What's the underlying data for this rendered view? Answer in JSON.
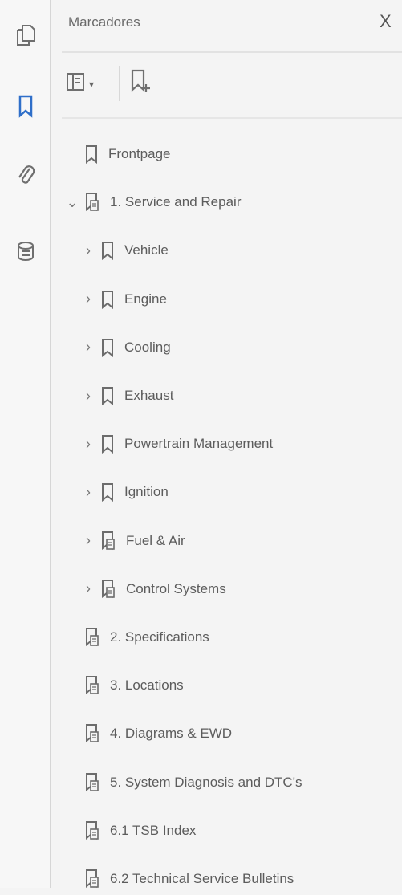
{
  "panel": {
    "title": "Marcadores",
    "close_label": "X"
  },
  "rail": {
    "icons": [
      "pages-icon",
      "bookmark-icon",
      "attachment-icon",
      "signature-icon"
    ]
  },
  "toolbar": {
    "options_icon": "bookmark-options-icon",
    "dropdown_icon": "chevron-down-icon",
    "new_bookmark_icon": "new-bookmark-icon"
  },
  "bookmarks": [
    {
      "label": "Frontpage",
      "level": 0,
      "expander": "none",
      "icon": "bookmark-icon"
    },
    {
      "label": "1. Service and Repair",
      "level": 0,
      "expander": "expanded",
      "icon": "bookmark-doc-icon"
    },
    {
      "label": "Vehicle",
      "level": 1,
      "expander": "collapsed",
      "icon": "bookmark-icon"
    },
    {
      "label": "Engine",
      "level": 1,
      "expander": "collapsed",
      "icon": "bookmark-icon"
    },
    {
      "label": "Cooling",
      "level": 1,
      "expander": "collapsed",
      "icon": "bookmark-icon"
    },
    {
      "label": "Exhaust",
      "level": 1,
      "expander": "collapsed",
      "icon": "bookmark-icon"
    },
    {
      "label": "Powertrain Management",
      "level": 1,
      "expander": "collapsed",
      "icon": "bookmark-icon"
    },
    {
      "label": "Ignition",
      "level": 1,
      "expander": "collapsed",
      "icon": "bookmark-icon"
    },
    {
      "label": "Fuel &  Air",
      "level": 1,
      "expander": "collapsed",
      "icon": "bookmark-doc-icon"
    },
    {
      "label": "Control Systems",
      "level": 1,
      "expander": "collapsed",
      "icon": "bookmark-doc-icon"
    },
    {
      "label": "2. Specifications",
      "level": 0,
      "expander": "none",
      "icon": "bookmark-doc-icon"
    },
    {
      "label": "3. Locations",
      "level": 0,
      "expander": "none",
      "icon": "bookmark-doc-icon"
    },
    {
      "label": "4. Diagrams & EWD",
      "level": 0,
      "expander": "none",
      "icon": "bookmark-doc-icon"
    },
    {
      "label": "5. System Diagnosis and DTC's",
      "level": 0,
      "expander": "none",
      "icon": "bookmark-doc-icon"
    },
    {
      "label": "6.1 TSB Index",
      "level": 0,
      "expander": "none",
      "icon": "bookmark-doc-icon"
    },
    {
      "label": "6.2 Technical Service Bulletins",
      "level": 0,
      "expander": "none",
      "icon": "bookmark-doc-icon"
    }
  ]
}
